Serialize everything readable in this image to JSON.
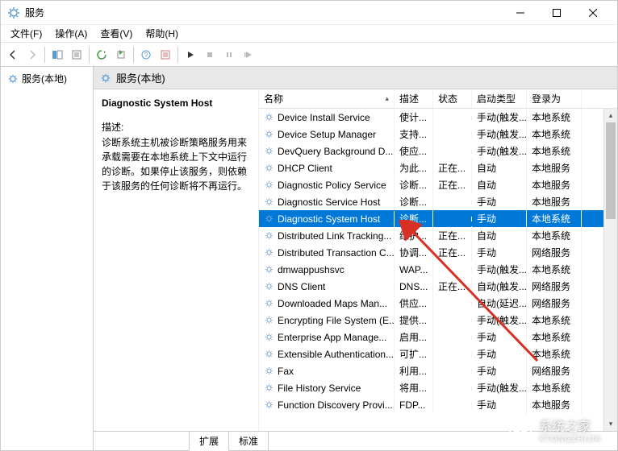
{
  "window": {
    "title": "服务"
  },
  "menu": {
    "file": "文件(F)",
    "action": "操作(A)",
    "view": "查看(V)",
    "help": "帮助(H)"
  },
  "tree": {
    "root": "服务(本地)"
  },
  "right_header": "服务(本地)",
  "detail": {
    "name": "Diagnostic System Host",
    "desc_label": "描述:",
    "desc": "诊断系统主机被诊断策略服务用来承载需要在本地系统上下文中运行的诊断。如果停止该服务，则依赖于该服务的任何诊断将不再运行。"
  },
  "columns": {
    "name": "名称",
    "desc": "描述",
    "status": "状态",
    "start": "启动类型",
    "logon": "登录为"
  },
  "services": [
    {
      "name": "Device Install Service",
      "desc": "使计...",
      "status": "",
      "start": "手动(触发...",
      "logon": "本地系统"
    },
    {
      "name": "Device Setup Manager",
      "desc": "支持...",
      "status": "",
      "start": "手动(触发...",
      "logon": "本地系统"
    },
    {
      "name": "DevQuery Background D...",
      "desc": "使应...",
      "status": "",
      "start": "手动(触发...",
      "logon": "本地系统"
    },
    {
      "name": "DHCP Client",
      "desc": "为此...",
      "status": "正在...",
      "start": "自动",
      "logon": "本地服务"
    },
    {
      "name": "Diagnostic Policy Service",
      "desc": "诊断...",
      "status": "正在...",
      "start": "自动",
      "logon": "本地服务"
    },
    {
      "name": "Diagnostic Service Host",
      "desc": "诊断...",
      "status": "",
      "start": "手动",
      "logon": "本地服务"
    },
    {
      "name": "Diagnostic System Host",
      "desc": "诊断...",
      "status": "",
      "start": "手动",
      "logon": "本地系统",
      "selected": true
    },
    {
      "name": "Distributed Link Tracking...",
      "desc": "维护...",
      "status": "正在...",
      "start": "自动",
      "logon": "本地系统"
    },
    {
      "name": "Distributed Transaction C...",
      "desc": "协调...",
      "status": "正在...",
      "start": "手动",
      "logon": "网络服务"
    },
    {
      "name": "dmwappushsvc",
      "desc": "WAP...",
      "status": "",
      "start": "手动(触发...",
      "logon": "本地系统"
    },
    {
      "name": "DNS Client",
      "desc": "DNS...",
      "status": "正在...",
      "start": "自动(触发...",
      "logon": "网络服务"
    },
    {
      "name": "Downloaded Maps Man...",
      "desc": "供应...",
      "status": "",
      "start": "自动(延迟...",
      "logon": "网络服务"
    },
    {
      "name": "Encrypting File System (E...",
      "desc": "提供...",
      "status": "",
      "start": "手动(触发...",
      "logon": "本地系统"
    },
    {
      "name": "Enterprise App Manage...",
      "desc": "启用...",
      "status": "",
      "start": "手动",
      "logon": "本地系统"
    },
    {
      "name": "Extensible Authentication...",
      "desc": "可扩...",
      "status": "",
      "start": "手动",
      "logon": "本地系统"
    },
    {
      "name": "Fax",
      "desc": "利用...",
      "status": "",
      "start": "手动",
      "logon": "网络服务"
    },
    {
      "name": "File History Service",
      "desc": "将用...",
      "status": "",
      "start": "手动(触发...",
      "logon": "本地系统"
    },
    {
      "name": "Function Discovery Provi...",
      "desc": "FDP...",
      "status": "",
      "start": "手动",
      "logon": "本地服务"
    }
  ],
  "tabs": {
    "extended": "扩展",
    "standard": "标准"
  },
  "watermark": {
    "main": "系统之家",
    "sub": "XTONGZHIJIA"
  }
}
